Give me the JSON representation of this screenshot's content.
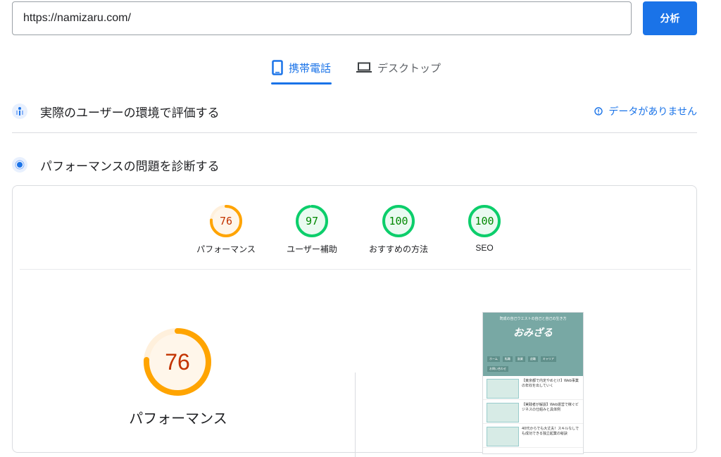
{
  "url_input": {
    "value": "https://namizaru.com/"
  },
  "analyze_button": {
    "label": "分析"
  },
  "tabs": [
    {
      "label": "携帯電話",
      "active": true,
      "icon": "smartphone-icon"
    },
    {
      "label": "デスクトップ",
      "active": false,
      "icon": "laptop-icon"
    }
  ],
  "field_data": {
    "title": "実際のユーザーの環境で評価する",
    "status": "データがありません",
    "icon": "users-icon"
  },
  "lab_data": {
    "title": "パフォーマンスの問題を診断する",
    "icon": "lab-icon"
  },
  "scores": [
    {
      "value": "76",
      "label": "パフォーマンス",
      "color": "#ffa400"
    },
    {
      "value": "97",
      "label": "ユーザー補助",
      "color": "#0cce6b"
    },
    {
      "value": "100",
      "label": "おすすめの方法",
      "color": "#0cce6b"
    },
    {
      "value": "100",
      "label": "SEO",
      "color": "#0cce6b"
    }
  ],
  "big_score": {
    "value": "76",
    "label": "パフォーマンス",
    "color": "#ffa400"
  },
  "thumbnail": {
    "site_tagline": "既成の自己ウエストの自己と自己の生き方",
    "logo": "おみざる",
    "nav": [
      "ホーム",
      "転職",
      "副業",
      "退職",
      "キャリア",
      "お問い合わせ"
    ],
    "posts": [
      {
        "text": "【東京都で内定やめとけ】Web事業の年収を出していく"
      },
      {
        "text": "【実践者が解説】Web運営で稼ぐビジネスの仕組みと具体例"
      },
      {
        "text": "40代からでも大丈夫！スキルなしでも成功できる独立起業の秘訣"
      }
    ]
  }
}
